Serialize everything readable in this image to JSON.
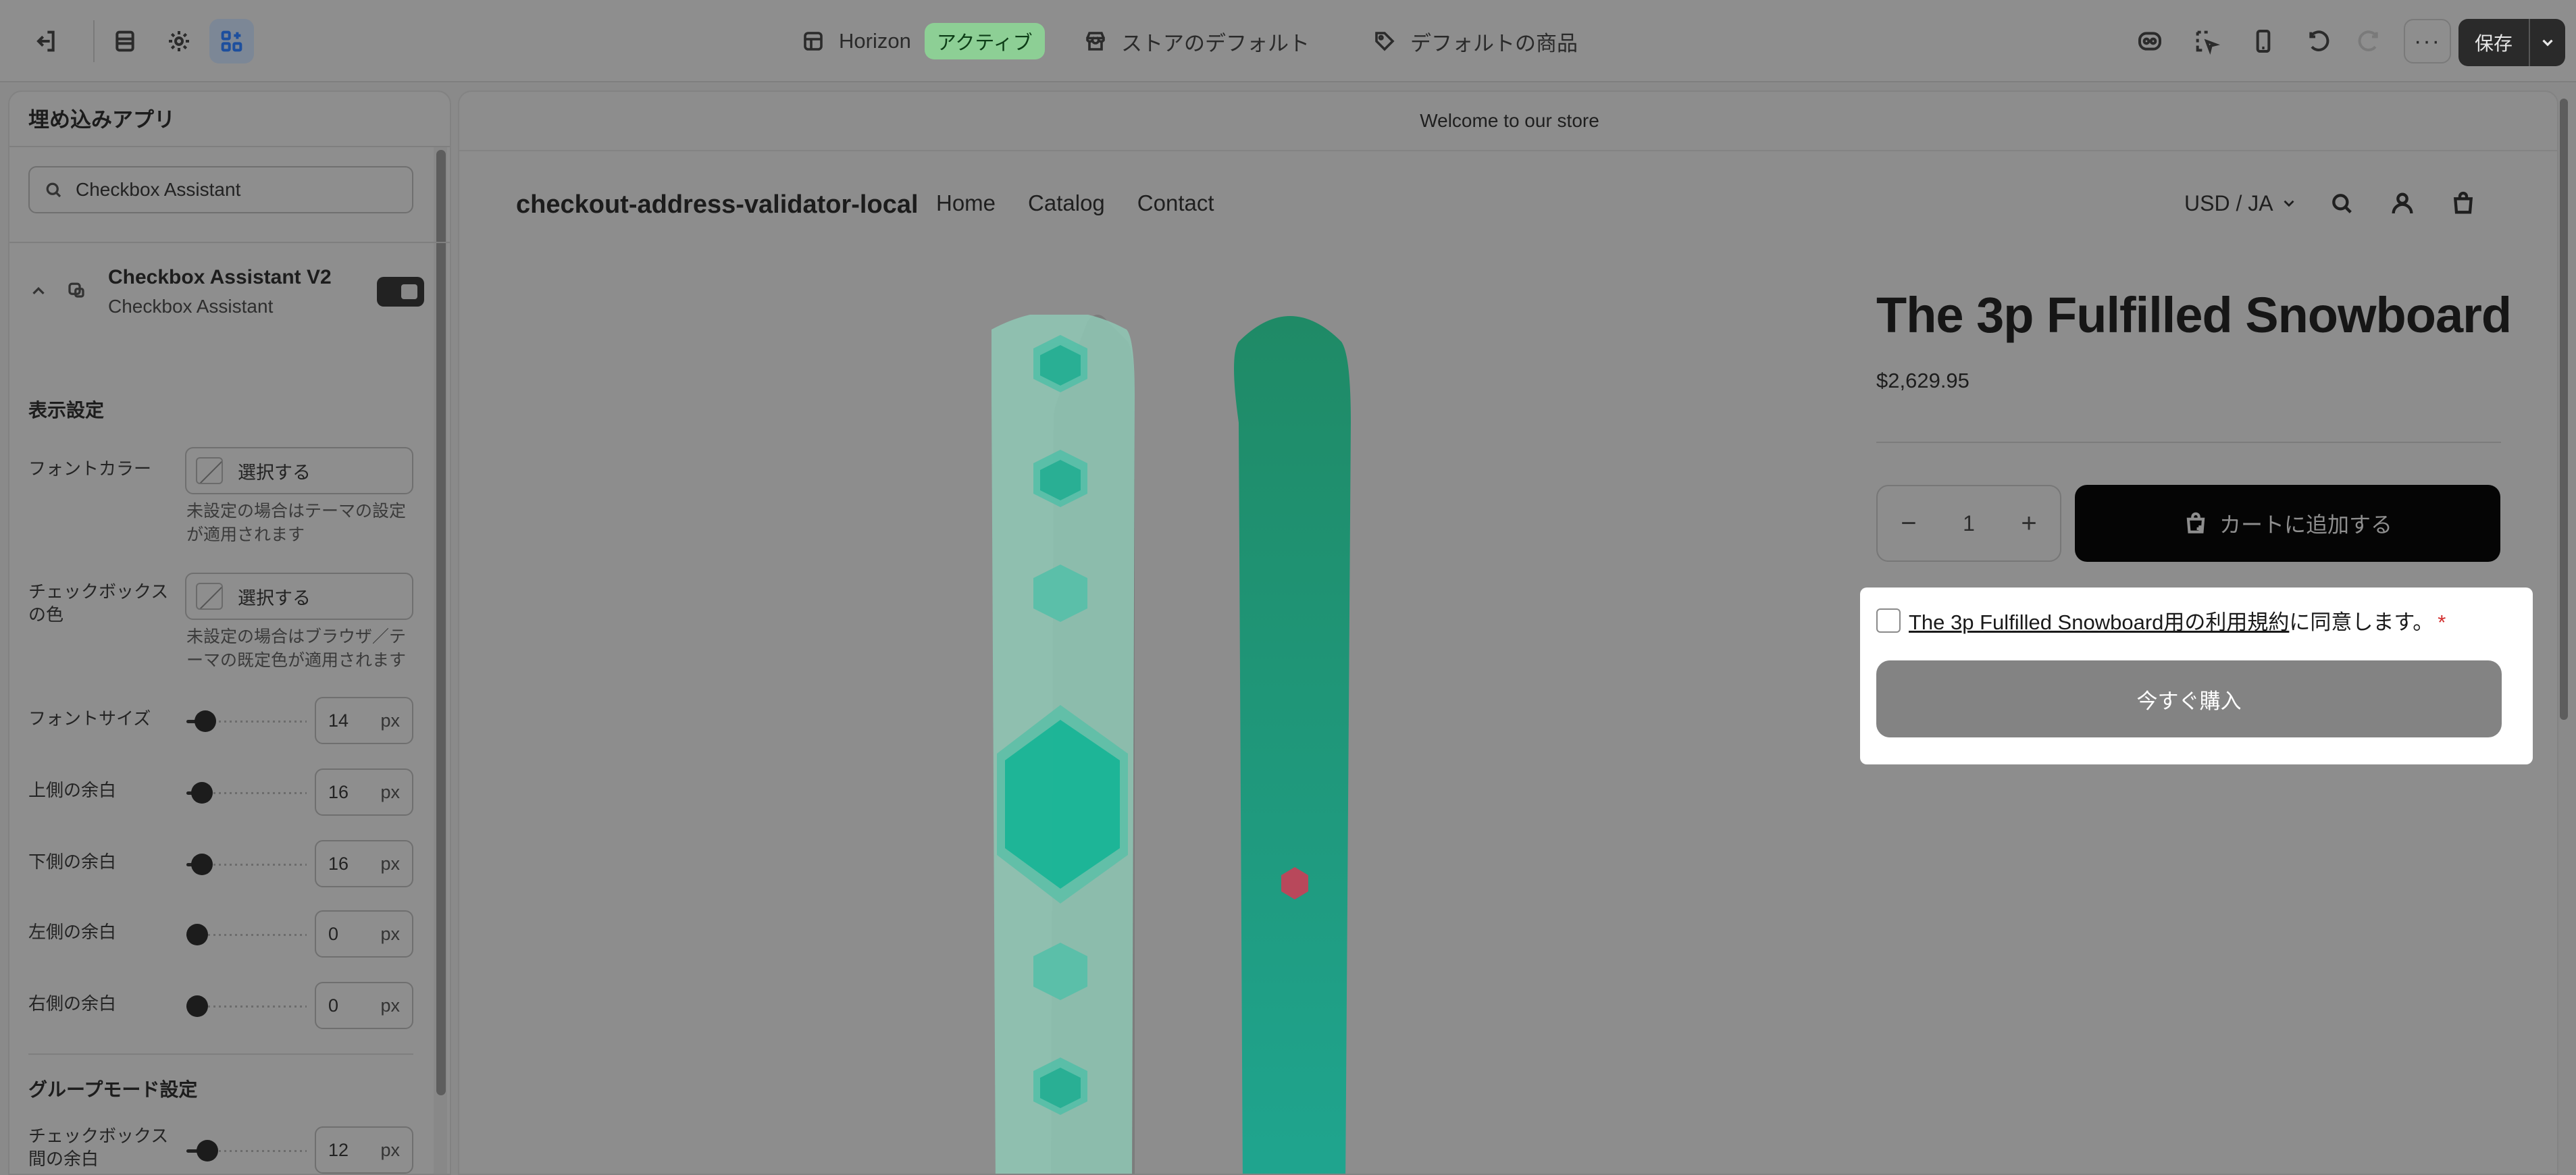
{
  "topbar": {
    "theme_name": "Horizon",
    "theme_status": "アクティブ",
    "store_default": "ストアのデフォルト",
    "default_product": "デフォルトの商品",
    "save_label": "保存"
  },
  "panel": {
    "title": "埋め込みアプリ",
    "search_value": "Checkbox Assistant",
    "app": {
      "name": "Checkbox Assistant V2",
      "subtitle": "Checkbox Assistant",
      "enabled": true
    },
    "display_section": "表示設定",
    "font_color": {
      "label": "フォントカラー",
      "button": "選択する",
      "hint": "未設定の場合はテーマの設定が適用されます"
    },
    "checkbox_color": {
      "label": "チェックボックスの色",
      "button": "選択する",
      "hint": "未設定の場合はブラウザ／テーマの既定色が適用されます"
    },
    "sliders": [
      {
        "label": "フォントサイズ",
        "value": "14",
        "unit": "px",
        "level": 0.08
      },
      {
        "label": "上側の余白",
        "value": "16",
        "unit": "px",
        "level": 0.05
      },
      {
        "label": "下側の余白",
        "value": "16",
        "unit": "px",
        "level": 0.05
      },
      {
        "label": "左側の余白",
        "value": "0",
        "unit": "px",
        "level": 0.0
      },
      {
        "label": "右側の余白",
        "value": "0",
        "unit": "px",
        "level": 0.0
      }
    ],
    "group_section": "グループモード設定",
    "group_slider": {
      "label": "チェックボックス間の余白",
      "value": "12",
      "unit": "px",
      "level": 0.1
    }
  },
  "preview": {
    "announcement": "Welcome to our store",
    "store_name": "checkout-address-validator-local",
    "nav": [
      "Home",
      "Catalog",
      "Contact"
    ],
    "currency": "USD / JA",
    "product_title": "The 3p Fulfilled Snowboard",
    "price": "$2,629.95",
    "quantity": "1",
    "add_to_cart": "カートに追加する",
    "agree_link": "The 3p Fulfilled Snowboard用の利用規約",
    "agree_suffix": "に同意します。",
    "required_mark": "*",
    "buy_now": "今すぐ購入"
  },
  "colors": {
    "badge": "#8dcf95",
    "required": "#d32f2f",
    "board_mint": "#1fbf9f",
    "board_green": "#1f9a6e",
    "board_logo": "#c4495c"
  }
}
